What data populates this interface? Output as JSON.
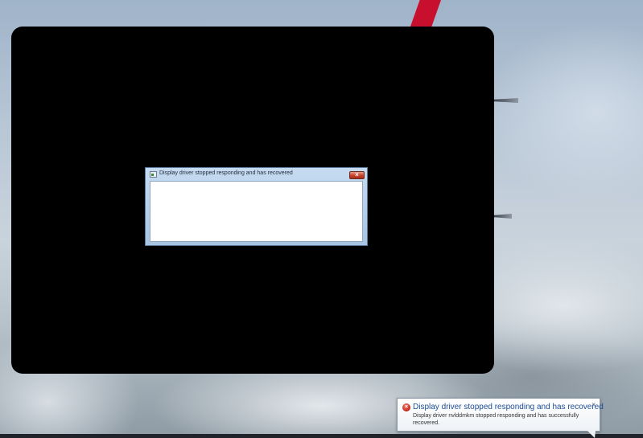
{
  "dialog": {
    "title": "Display driver stopped responding and has recovered",
    "close_glyph": "×",
    "icon": "application-icon"
  },
  "notification": {
    "title": "Display driver stopped responding and has recovered",
    "message": "Display driver nvlddmkm stopped responding and has successfully recovered.",
    "close_glyph": "×",
    "icon": "error-icon",
    "icon_glyph": "×"
  },
  "colors": {
    "title_blue": "#1e4e96",
    "close_red": "#c7422a",
    "error_red": "#c0261a"
  }
}
